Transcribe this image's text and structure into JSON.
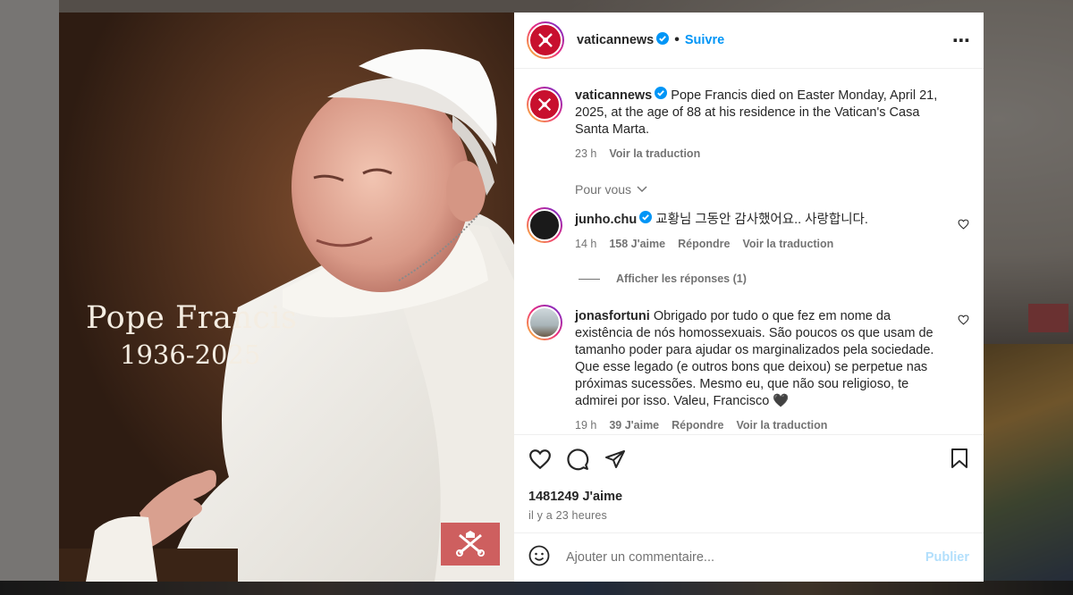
{
  "post": {
    "image": {
      "title_text": "Pope Francis",
      "years_text": "1936-2025",
      "watermark": "VATICAN NEWS"
    },
    "header": {
      "username": "vaticannews",
      "follow_label": "Suivre",
      "more_icon": "more-horizontal-icon"
    },
    "caption": {
      "username": "vaticannews",
      "text": "Pope Francis died on Easter Monday, April 21, 2025, at the age of 88 at his residence in the Vatican's Casa Santa Marta.",
      "time": "23 h",
      "translate": "Voir la traduction"
    },
    "for_you_label": "Pour vous",
    "comments": [
      {
        "username": "junho.chu",
        "verified": true,
        "text": "교황님 그동안 감사했어요.. 사랑합니다.",
        "time": "14 h",
        "likes": "158 J'aime",
        "reply": "Répondre",
        "translate": "Voir la traduction"
      },
      {
        "username": "jonasfortuni",
        "verified": false,
        "text": "Obrigado por tudo o que fez em nome da existência de nós homossexuais. São poucos os que usam de tamanho poder para ajudar os marginalizados pela sociedade. Que esse legado (e outros bons que deixou) se perpetue nas próximas sucessões. Mesmo eu, que não sou religioso, te admirei por isso. Valeu, Francisco 🖤",
        "time": "19 h",
        "likes": "39 J'aime",
        "reply": "Répondre",
        "translate": "Voir la traduction"
      }
    ],
    "view_replies": "Afficher les réponses (1)",
    "likes_count": "1481249 J'aime",
    "posted": "il y a 23 heures",
    "add_comment_placeholder": "Ajouter un commentaire...",
    "publish_label": "Publier",
    "colors": {
      "link": "#0095f6",
      "brand_red": "#c8102e",
      "muted": "#737373"
    }
  }
}
